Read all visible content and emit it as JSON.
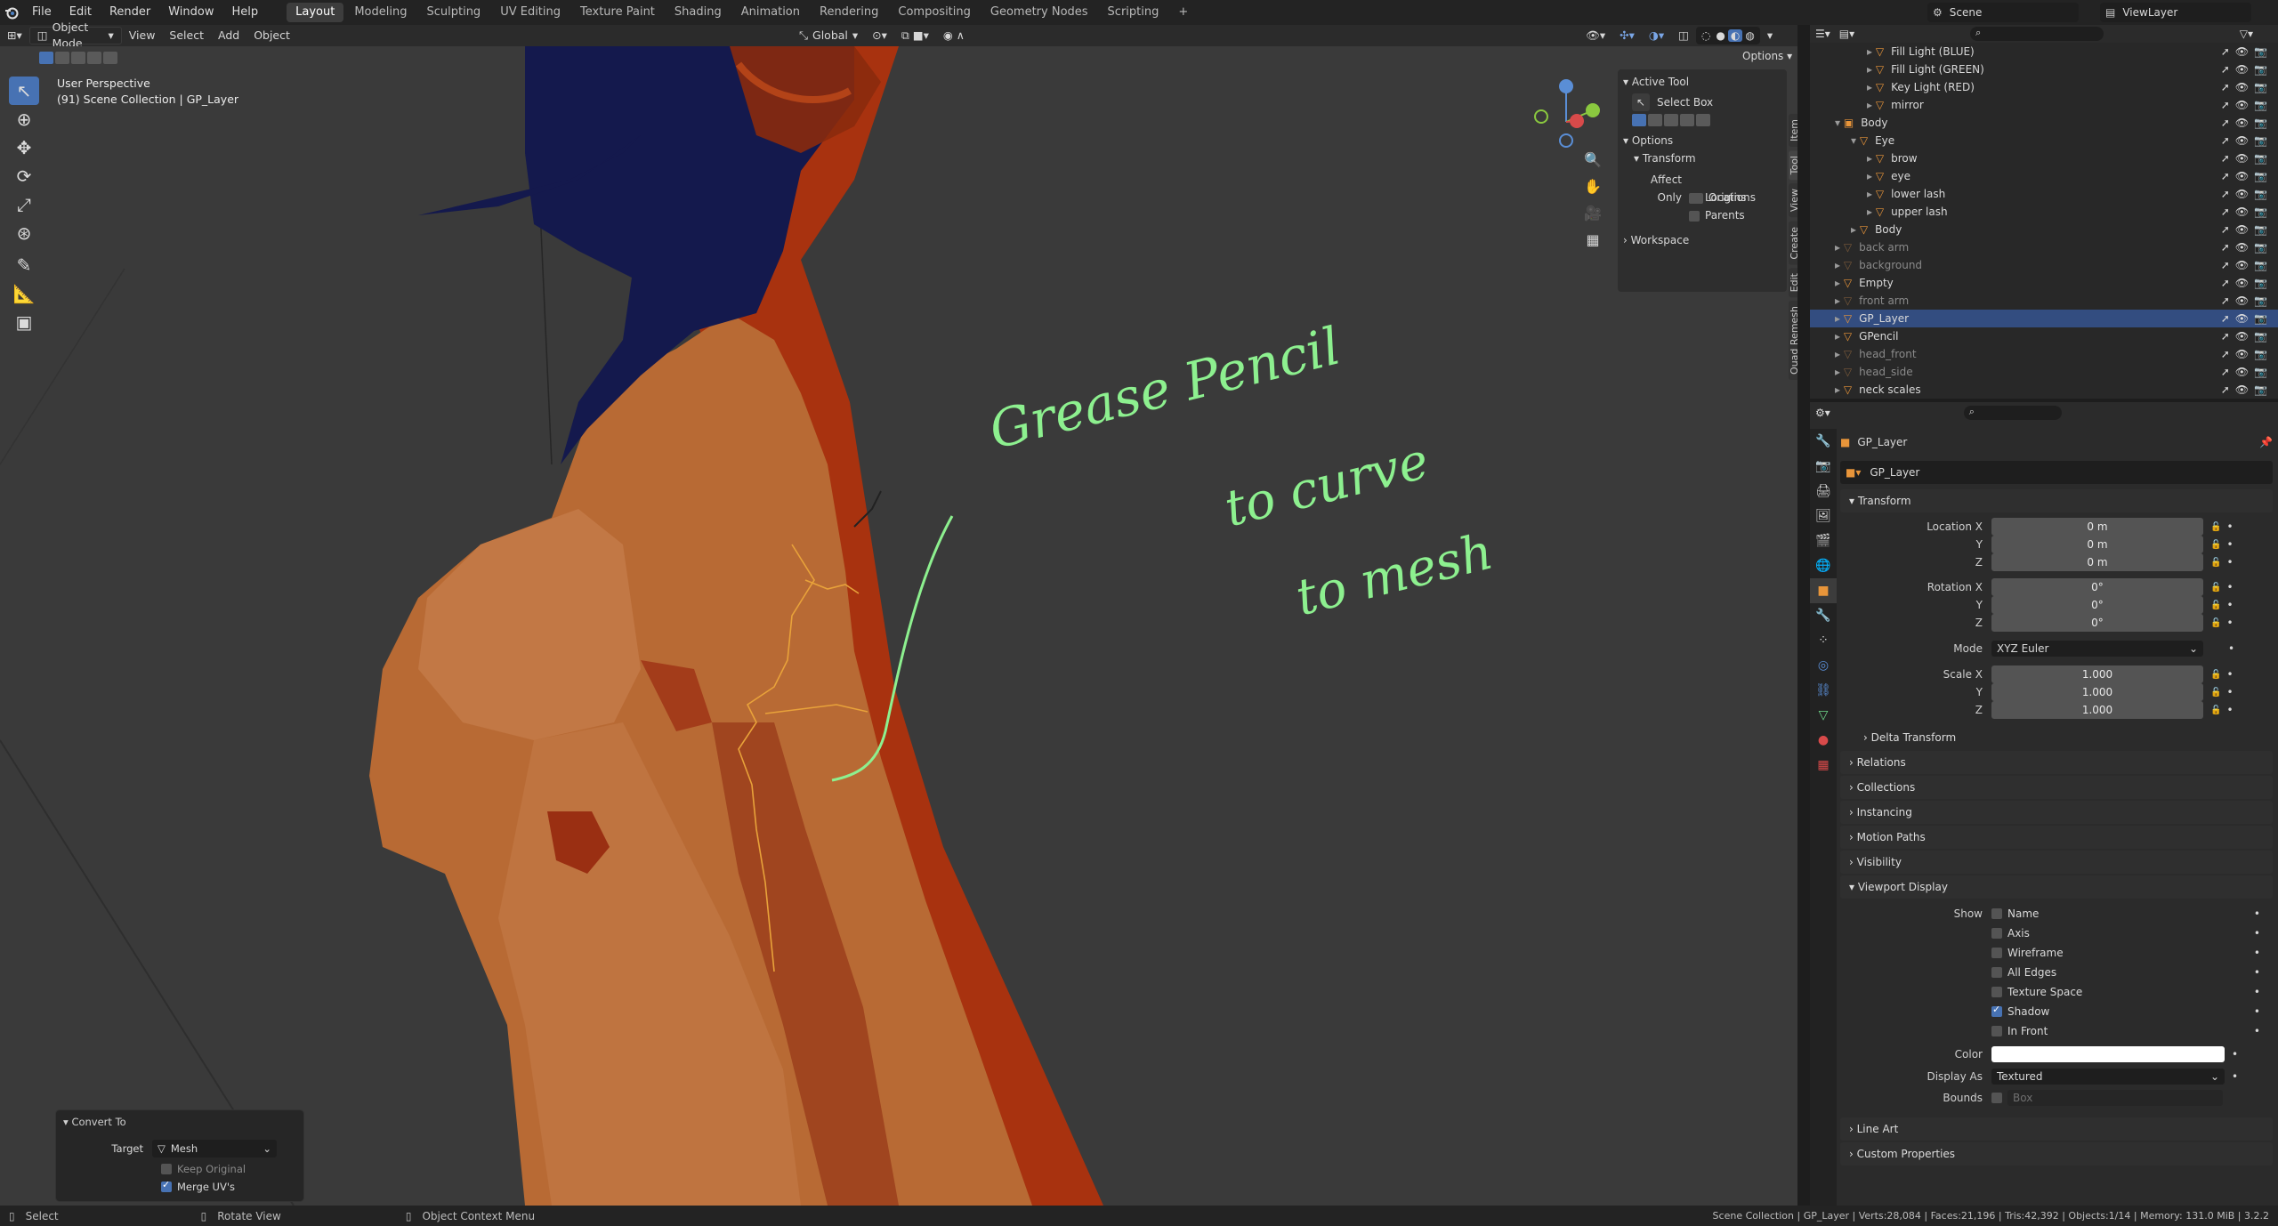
{
  "topbar": {
    "menus": [
      "File",
      "Edit",
      "Render",
      "Window",
      "Help"
    ],
    "workspaces": [
      "Layout",
      "Modeling",
      "Sculpting",
      "UV Editing",
      "Texture Paint",
      "Shading",
      "Animation",
      "Rendering",
      "Compositing",
      "Geometry Nodes",
      "Scripting"
    ],
    "active_workspace": "Layout",
    "add_workspace": "+",
    "scene": "Scene",
    "view_layer": "ViewLayer"
  },
  "viewport_header": {
    "mode": "Object Mode",
    "menus": [
      "View",
      "Select",
      "Add",
      "Object"
    ],
    "transform_orientation": "Global",
    "options": "Options"
  },
  "viewport": {
    "perspective": "User Perspective",
    "collection_path": "(91) Scene Collection | GP_Layer",
    "annotation_lines": [
      "Grease Pencil",
      "to curve",
      "to mesh"
    ]
  },
  "npanel": {
    "active_tool_title": "Active Tool",
    "active_tool_name": "Select Box",
    "options_title": "Options",
    "transform_title": "Transform",
    "affect_only": "Affect Only",
    "affect_items": [
      "Origins",
      "Locations",
      "Parents"
    ],
    "workspace_title": "Workspace",
    "tabs": [
      "Item",
      "Tool",
      "View",
      "Create",
      "Edit",
      "Quad Remesh"
    ]
  },
  "outliner": {
    "rows": [
      {
        "label": "Fill Light (BLUE)",
        "indent": 3,
        "dim": false,
        "selected": false
      },
      {
        "label": "Fill Light (GREEN)",
        "indent": 3,
        "dim": false,
        "selected": false
      },
      {
        "label": "Key Light (RED)",
        "indent": 3,
        "dim": false,
        "selected": false
      },
      {
        "label": "mirror",
        "indent": 3,
        "dim": false,
        "selected": false
      },
      {
        "label": "Body",
        "indent": 1,
        "dim": false,
        "selected": false
      },
      {
        "label": "Eye",
        "indent": 2,
        "dim": false,
        "selected": false
      },
      {
        "label": "brow",
        "indent": 3,
        "dim": false,
        "selected": false
      },
      {
        "label": "eye",
        "indent": 3,
        "dim": false,
        "selected": false
      },
      {
        "label": "lower lash",
        "indent": 3,
        "dim": false,
        "selected": false
      },
      {
        "label": "upper lash",
        "indent": 3,
        "dim": false,
        "selected": false
      },
      {
        "label": "Body",
        "indent": 2,
        "dim": false,
        "selected": false
      },
      {
        "label": "back arm",
        "indent": 1,
        "dim": true,
        "selected": false
      },
      {
        "label": "background",
        "indent": 1,
        "dim": true,
        "selected": false
      },
      {
        "label": "Empty",
        "indent": 1,
        "dim": false,
        "selected": false
      },
      {
        "label": "front arm",
        "indent": 1,
        "dim": true,
        "selected": false
      },
      {
        "label": "GP_Layer",
        "indent": 1,
        "dim": false,
        "selected": true
      },
      {
        "label": "GPencil",
        "indent": 1,
        "dim": false,
        "selected": false
      },
      {
        "label": "head_front",
        "indent": 1,
        "dim": true,
        "selected": false
      },
      {
        "label": "head_side",
        "indent": 1,
        "dim": true,
        "selected": false
      },
      {
        "label": "neck scales",
        "indent": 1,
        "dim": false,
        "selected": false
      }
    ]
  },
  "properties": {
    "object_name": "GP_Layer",
    "object_field": "GP_Layer",
    "transform_title": "Transform",
    "location_label": "Location X",
    "rotation_label": "Rotation X",
    "scale_label": "Scale X",
    "axis_y": "Y",
    "axis_z": "Z",
    "location": [
      "0 m",
      "0 m",
      "0 m"
    ],
    "rotation": [
      "0°",
      "0°",
      "0°"
    ],
    "mode_label": "Mode",
    "mode_value": "XYZ Euler",
    "scale": [
      "1.000",
      "1.000",
      "1.000"
    ],
    "delta_transform": "Delta Transform",
    "collapsed_panels": [
      "Relations",
      "Collections",
      "Instancing",
      "Motion Paths",
      "Visibility"
    ],
    "viewport_display_title": "Viewport Display",
    "show_label": "Show",
    "show_items": [
      {
        "label": "Name",
        "checked": false
      },
      {
        "label": "Axis",
        "checked": false
      },
      {
        "label": "Wireframe",
        "checked": false
      },
      {
        "label": "All Edges",
        "checked": false
      },
      {
        "label": "Texture Space",
        "checked": false
      },
      {
        "label": "Shadow",
        "checked": true
      },
      {
        "label": "In Front",
        "checked": false
      }
    ],
    "color_label": "Color",
    "display_as_label": "Display As",
    "display_as_value": "Textured",
    "bounds_label": "Bounds",
    "bounds_value": "Box",
    "bottom_panels": [
      "Line Art",
      "Custom Properties"
    ]
  },
  "operator_panel": {
    "title": "Convert To",
    "target_label": "Target",
    "target_value": "Mesh",
    "keep_original": "Keep Original",
    "merge_uvs": "Merge UV's"
  },
  "statusbar": {
    "select": "Select",
    "rotate_view": "Rotate View",
    "context_menu": "Object Context Menu",
    "stats": "Scene Collection | GP_Layer | Verts:28,084 | Faces:21,196 | Tris:42,392 | Objects:1/14 | Memory: 131.0 MiB | 3.2.2"
  },
  "colors": {
    "accent": "#4772b3",
    "skin": "#b86a34",
    "shadow_red": "#a8320f",
    "navy": "#14194d",
    "annotation_green": "#8df08f",
    "selected_row": "#334d80"
  }
}
